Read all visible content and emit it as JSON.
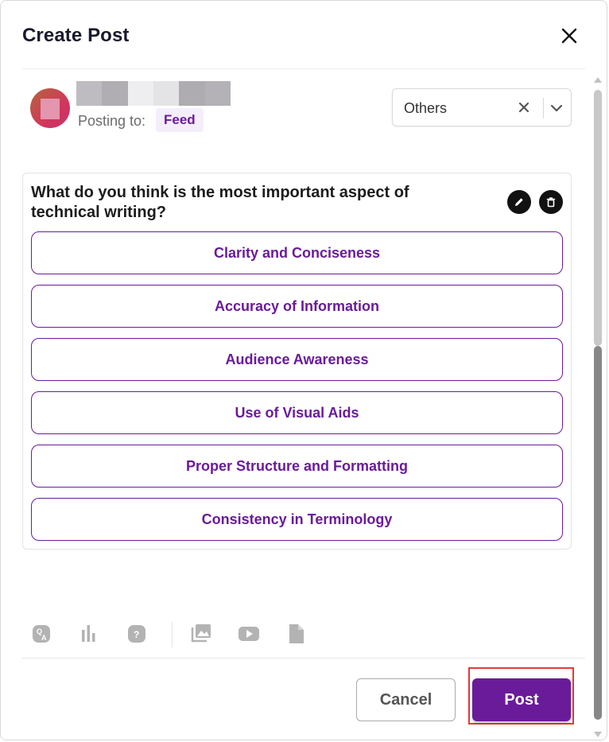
{
  "modal": {
    "title": "Create Post",
    "close_icon": "close-icon"
  },
  "author": {
    "posting_label": "Posting to:",
    "destination": "Feed",
    "name_redacted_colors": [
      "#bfbcc1",
      "#b0aeb3",
      "#eeedef",
      "#e4e3e6",
      "#aeacb1",
      "#b4b2b6"
    ]
  },
  "category": {
    "selected": "Others",
    "clear_icon": "clear-x-icon",
    "toggle_icon": "chevron-down-icon"
  },
  "poll": {
    "question": "What do you think is the most important aspect of technical writing?",
    "edit_icon": "pencil-icon",
    "delete_icon": "trash-icon",
    "options": [
      "Clarity and Conciseness",
      "Accuracy of Information",
      "Audience Awareness",
      "Use of Visual Aids",
      "Proper Structure and Formatting",
      "Consistency in Terminology"
    ]
  },
  "toolbar": {
    "tools": [
      "qa-icon",
      "poll-chart-icon",
      "question-icon",
      "image-gallery-icon",
      "youtube-icon",
      "document-icon"
    ]
  },
  "footer": {
    "cancel_label": "Cancel",
    "post_label": "Post"
  },
  "colors": {
    "accent": "#6a1b9a",
    "highlight": "#e53935"
  }
}
